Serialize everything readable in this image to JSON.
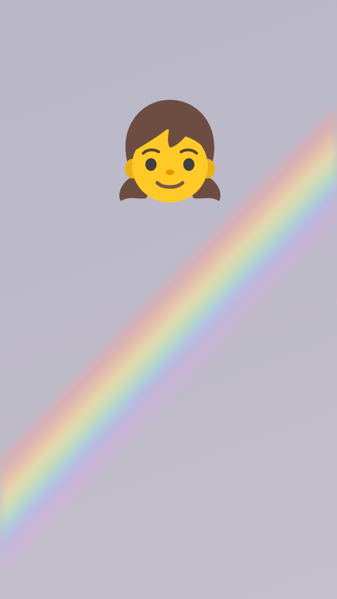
{
  "image": {
    "background_color": "#bcbac8",
    "rainbow_colors": [
      "#e8a8a8",
      "#f0c8a0",
      "#f2e6a8",
      "#c8e8b0",
      "#a8d8e0",
      "#b4b8ec",
      "#d4b0e0"
    ],
    "sticker": {
      "icon": "girl-emoji-icon",
      "skin_color": "#ffca28",
      "hair_color": "#6d4c41"
    }
  }
}
